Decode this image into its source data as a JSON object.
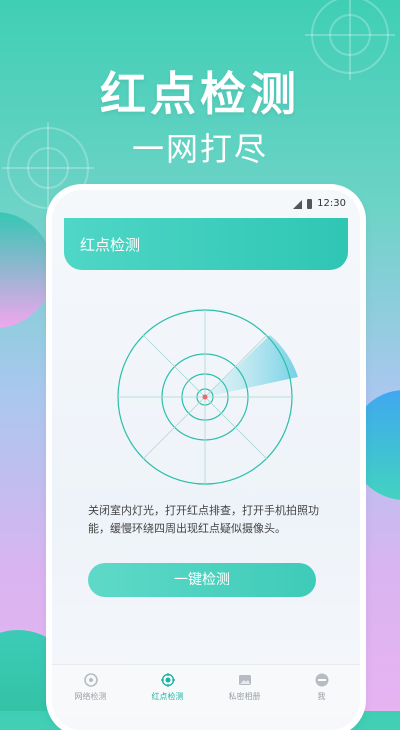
{
  "hero": {
    "title": "红点检测",
    "subtitle": "一网打尽"
  },
  "status": {
    "time": "12:30"
  },
  "app": {
    "title": "红点检测",
    "description": "关闭室内灯光，打开红点排查，打开手机拍照功能，缓慢环绕四周出现红点疑似摄像头。",
    "action_button": "一键检测"
  },
  "tabs": [
    {
      "label": "网络检测",
      "icon": "network-icon",
      "active": false
    },
    {
      "label": "红点检测",
      "icon": "radar-target-icon",
      "active": true
    },
    {
      "label": "私密相册",
      "icon": "photo-icon",
      "active": false
    },
    {
      "label": "我",
      "icon": "profile-icon",
      "active": false
    }
  ],
  "colors": {
    "accent": "#3ecbb8",
    "active_tab": "#1fb3a5"
  }
}
